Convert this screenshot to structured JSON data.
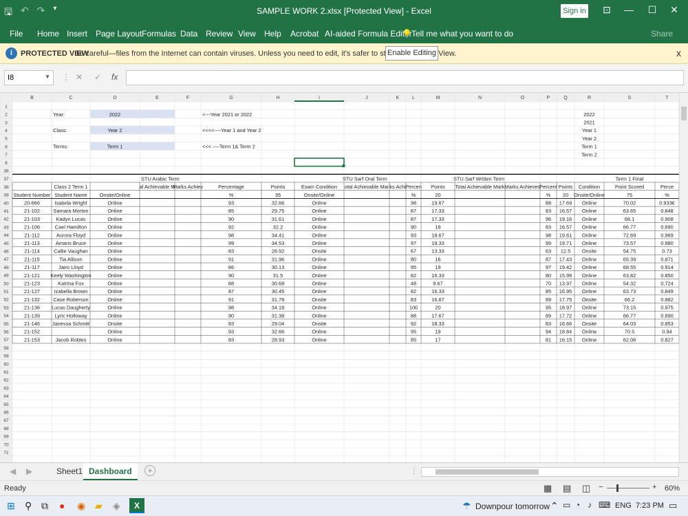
{
  "window": {
    "title": "SAMPLE WORK 2.xlsx  [Protected View]  -  Excel",
    "signin": "Sign in"
  },
  "ribbon": {
    "tabs": [
      "File",
      "Home",
      "Insert",
      "Page Layout",
      "Formulas",
      "Data",
      "Review",
      "View",
      "Help",
      "Acrobat",
      "AI-aided Formula Editor"
    ],
    "tell": "Tell me what you want to do",
    "share": "Share"
  },
  "protected": {
    "title": "PROTECTED VIEW",
    "message": "Be careful—files from the Internet can contain viruses. Unless you need to edit, it's safer to stay in Protected View.",
    "button": "Enable Editing",
    "close": "x"
  },
  "formula": {
    "namebox": "I8",
    "fx": "fx",
    "cancel": "✕",
    "confirm": "✓",
    "value": ""
  },
  "columns": [
    "B",
    "C",
    "D",
    "E",
    "F",
    "G",
    "H",
    "I",
    "J",
    "K",
    "L",
    "M",
    "N",
    "O",
    "P",
    "Q",
    "R",
    "S",
    "T"
  ],
  "rows_top": [
    "1",
    "2",
    "3",
    "4",
    "5",
    "6",
    "7",
    "8",
    "36",
    "37",
    "38",
    "39"
  ],
  "top_cells": {
    "year_label": "Year:",
    "year_val": "2022",
    "year_note": "<---Year 2021 or 2022",
    "class_label": "Class:",
    "class_val": "Year 2",
    "class_note": "<<<<----Year 1 and Year 2",
    "terms_label": "Terms:",
    "terms_val": "Term 1",
    "terms_note": "<<< ----Term 1& Term 2",
    "list": [
      "2022",
      "2021",
      "Year 1",
      "Year 2",
      "Term 1",
      "Term 2"
    ]
  },
  "headers": {
    "arabic": "STU Arabic Term",
    "oral": "STU Sarf Oral Term",
    "written": "STU Sarf Written Term",
    "final": "Term 1 Final",
    "class_term": "Class 2 Term 1",
    "r38": [
      "",
      "Class 2 Term 1",
      "",
      "al Achievable M",
      "Marks Achiev",
      "Percentage",
      "Points",
      "Exam Condition",
      "otal Achievable Mar",
      "ks Achi",
      "Percen",
      "Points",
      "Total Achievable Mark",
      "Marks Achieved",
      "Percent",
      "Points",
      "Condition",
      "Point Scored",
      "Perce"
    ],
    "r39": [
      "Student Number",
      "Student Name",
      "Onsite/Online",
      "",
      "",
      "%",
      "35",
      "Onsite/Online",
      "",
      "",
      "%",
      "20",
      "",
      "",
      "%",
      "20",
      "Onsite/Online",
      "75",
      "%"
    ]
  },
  "students": [
    {
      "row": "40",
      "num": "20-666",
      "name": "Isabela Wright",
      "d": "Online",
      "g": "93",
      "h": "32.66",
      "i": "Online",
      "l": "98",
      "m": "19.67",
      "p": "88",
      "q": "17.69",
      "r": "Online",
      "s": "70.02",
      "t": "0.933€"
    },
    {
      "row": "41",
      "num": "21-102",
      "name": "Samara Morton",
      "d": "Online",
      "g": "85",
      "h": "29.75",
      "i": "Online",
      "l": "87",
      "m": "17.33",
      "p": "83",
      "q": "16.57",
      "r": "Online",
      "s": "63.65",
      "t": "0.848"
    },
    {
      "row": "42",
      "num": "21-103",
      "name": "Kadyn Lucas",
      "d": "Online",
      "g": "90",
      "h": "31.61",
      "i": "Online",
      "l": "87",
      "m": "17.33",
      "p": "96",
      "q": "19.16",
      "r": "Online",
      "s": "68.1",
      "t": "0.908"
    },
    {
      "row": "43",
      "num": "21-106",
      "name": "Cael Hamilton",
      "d": "Online",
      "g": "92",
      "h": "32.2",
      "i": "Online",
      "l": "90",
      "m": "18",
      "p": "83",
      "q": "16.57",
      "r": "Online",
      "s": "66.77",
      "t": "0.890"
    },
    {
      "row": "44",
      "num": "21-112",
      "name": "Aurora Floyd",
      "d": "Online",
      "g": "98",
      "h": "34.41",
      "i": "Online",
      "l": "93",
      "m": "18.67",
      "p": "98",
      "q": "19.61",
      "r": "Online",
      "s": "72.69",
      "t": "0.969"
    },
    {
      "row": "45",
      "num": "21-113",
      "name": "Amaris Bruce",
      "d": "Online",
      "g": "99",
      "h": "34.53",
      "i": "Online",
      "l": "97",
      "m": "19.33",
      "p": "99",
      "q": "19.71",
      "r": "Online",
      "s": "73.57",
      "t": "0.980"
    },
    {
      "row": "46",
      "num": "21-114",
      "name": "Callie Vaughan",
      "d": "Online",
      "g": "83",
      "h": "28.92",
      "i": "Onsite",
      "l": "67",
      "m": "13.33",
      "p": "63",
      "q": "12.5",
      "r": "Onsite",
      "s": "54.75",
      "t": "0.73"
    },
    {
      "row": "47",
      "num": "21-115",
      "name": "Tia Allison",
      "d": "Online",
      "g": "91",
      "h": "31.96",
      "i": "Online",
      "l": "80",
      "m": "16",
      "p": "87",
      "q": "17.43",
      "r": "Online",
      "s": "65.39",
      "t": "0.871"
    },
    {
      "row": "48",
      "num": "21-117",
      "name": "Jairo Lloyd",
      "d": "Online",
      "g": "86",
      "h": "30.13",
      "i": "Online",
      "l": "95",
      "m": "19",
      "p": "97",
      "q": "19.42",
      "r": "Online",
      "s": "68.55",
      "t": "0.914"
    },
    {
      "row": "49",
      "num": "21-121",
      "name": "Keely Washington",
      "d": "Online",
      "g": "90",
      "h": "31.5",
      "i": "Online",
      "l": "82",
      "m": "16.33",
      "p": "80",
      "q": "15.99",
      "r": "Online",
      "s": "63.82",
      "t": "0.850"
    },
    {
      "row": "50",
      "num": "21-123",
      "name": "Katrina Fox",
      "d": "Online",
      "g": "88",
      "h": "30.68",
      "i": "Online",
      "l": "48",
      "m": "9.67",
      "p": "70",
      "q": "13.97",
      "r": "Online",
      "s": "54.32",
      "t": "0.724"
    },
    {
      "row": "51",
      "num": "21-127",
      "name": "Izabella Brown",
      "d": "Online",
      "g": "87",
      "h": "30.45",
      "i": "Online",
      "l": "82",
      "m": "16.33",
      "p": "85",
      "q": "16.95",
      "r": "Online",
      "s": "63.73",
      "t": "0.849"
    },
    {
      "row": "52",
      "num": "21-132",
      "name": "Case Roberson",
      "d": "Online",
      "g": "91",
      "h": "31.78",
      "i": "Onsite",
      "l": "83",
      "m": "16.67",
      "p": "89",
      "q": "17.75",
      "r": "Onsite",
      "s": "66.2",
      "t": "0.882"
    },
    {
      "row": "53",
      "num": "21-136",
      "name": "Lucas Daugherty",
      "d": "Online",
      "g": "98",
      "h": "34.18",
      "i": "Online",
      "l": "100",
      "m": "20",
      "p": "95",
      "q": "18.97",
      "r": "Online",
      "s": "73.15",
      "t": "0.975"
    },
    {
      "row": "54",
      "num": "21-139",
      "name": "Lyric Holloway",
      "d": "Online",
      "g": "90",
      "h": "31.38",
      "i": "Online",
      "l": "88",
      "m": "17.67",
      "p": "89",
      "q": "17.72",
      "r": "Online",
      "s": "66.77",
      "t": "0.890"
    },
    {
      "row": "55",
      "num": "21-146",
      "name": "Janessa Schmitt",
      "d": "Onsite",
      "g": "83",
      "h": "29.04",
      "i": "Onsite",
      "l": "92",
      "m": "18.33",
      "p": "83",
      "q": "16.66",
      "r": "Onsite",
      "s": "64.03",
      "t": "0.853"
    },
    {
      "row": "56",
      "num": "21-152",
      "name": "",
      "d": "Online",
      "g": "93",
      "h": "32.66",
      "i": "Online",
      "l": "95",
      "m": "19",
      "p": "94",
      "q": "18.84",
      "r": "Online",
      "s": "70.5",
      "t": "0.94"
    },
    {
      "row": "57",
      "num": "21-153",
      "name": "Jacob Robles",
      "d": "Online",
      "g": "83",
      "h": "28.93",
      "i": "Online",
      "l": "85",
      "m": "17",
      "p": "81",
      "q": "16.15",
      "r": "Online",
      "s": "62.08",
      "t": "0.827"
    }
  ],
  "rows_bottom": [
    "58",
    "59",
    "60",
    "61",
    "62",
    "63",
    "64",
    "65",
    "66",
    "67",
    "68",
    "69",
    "70",
    "71"
  ],
  "sheets": [
    "Sheet1",
    "Dashboard"
  ],
  "status": {
    "ready": "Ready",
    "zoom": "60%"
  },
  "taskbar": {
    "weather": "Downpour tomorrow",
    "lang": "ENG",
    "time": "7:23 PM"
  },
  "colors": {
    "excel_green": "#217346",
    "highlight": "#d9e1f2"
  }
}
